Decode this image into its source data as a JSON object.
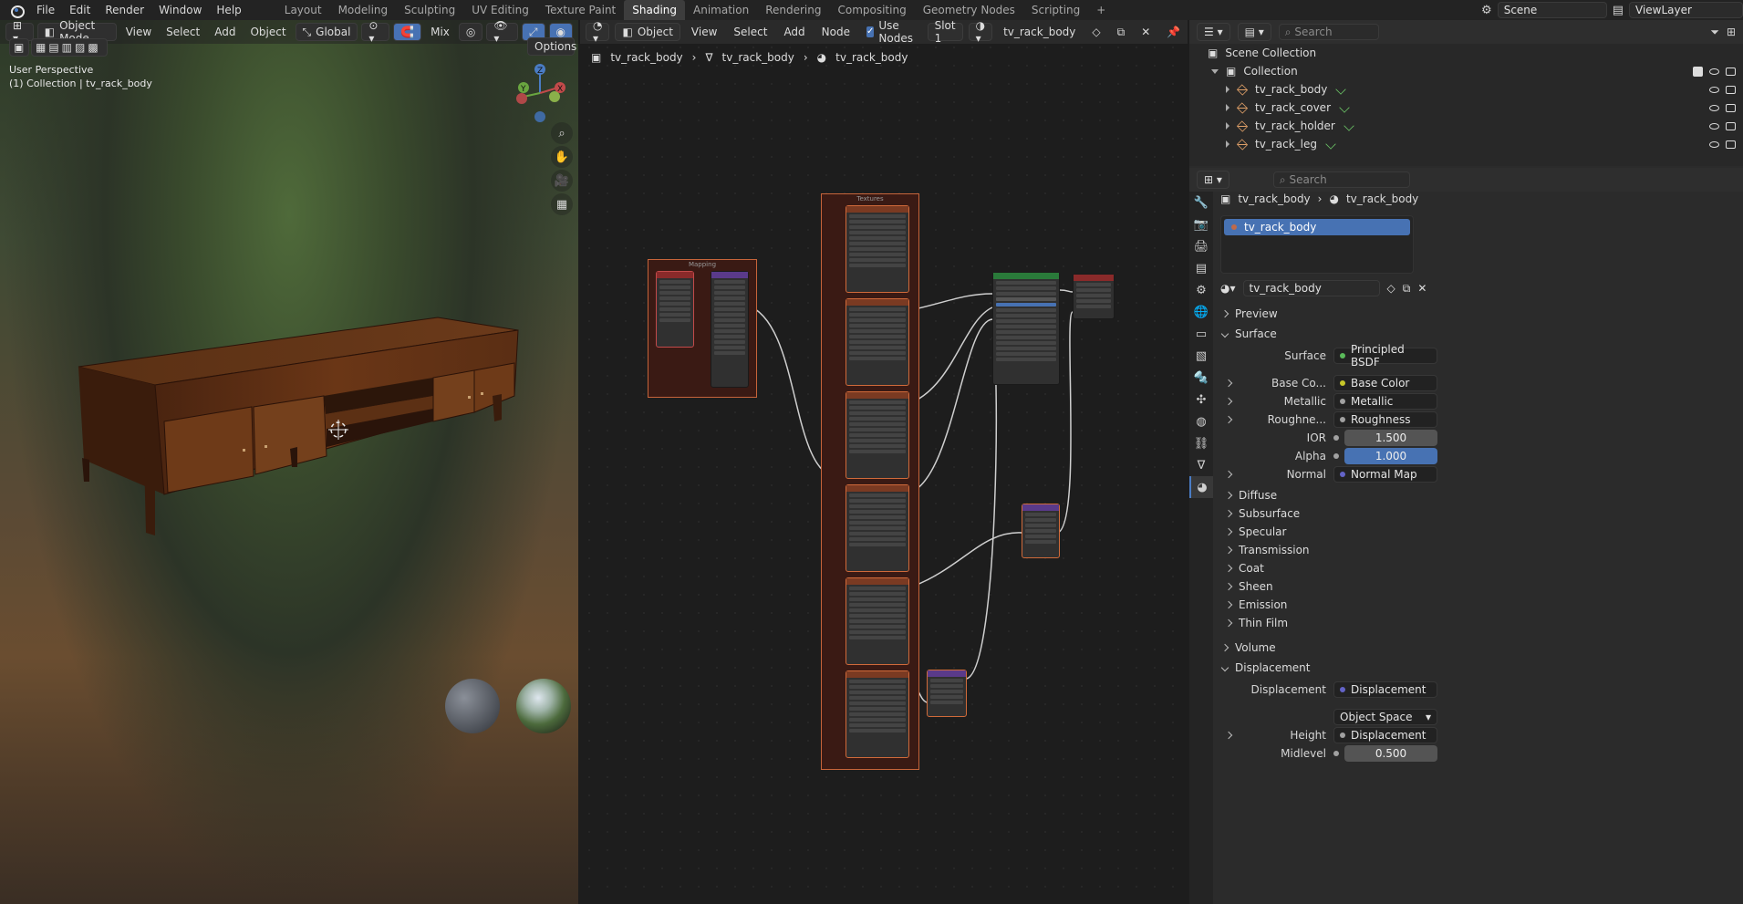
{
  "menu": {
    "file": "File",
    "edit": "Edit",
    "render": "Render",
    "window": "Window",
    "help": "Help"
  },
  "workspaces": [
    "Layout",
    "Modeling",
    "Sculpting",
    "UV Editing",
    "Texture Paint",
    "Shading",
    "Animation",
    "Rendering",
    "Compositing",
    "Geometry Nodes",
    "Scripting",
    "+"
  ],
  "active_workspace": "Shading",
  "top_right": {
    "scene": "Scene",
    "view_layer": "ViewLayer"
  },
  "viewport": {
    "mode": "Object Mode",
    "view": "View",
    "select": "Select",
    "add": "Add",
    "object": "Object",
    "transform": "Global",
    "shading_mix": "Mix",
    "options": "Options",
    "overlay_line1": "User Perspective",
    "overlay_line2": "(1) Collection | tv_rack_body",
    "axes": {
      "z": "Z",
      "y": "Y",
      "x": "X"
    }
  },
  "node_editor": {
    "type": "Object",
    "view": "View",
    "select": "Select",
    "add": "Add",
    "node": "Node",
    "use_nodes": "Use Nodes",
    "slot": "Slot 1",
    "material": "tv_rack_body",
    "breadcrumb": [
      "tv_rack_body",
      "tv_rack_body",
      "tv_rack_body"
    ],
    "frame_mapping": "Mapping",
    "frame_textures": "Textures"
  },
  "outliner": {
    "search_placeholder": "Search",
    "scene_collection": "Scene Collection",
    "collection": "Collection",
    "objects": [
      "tv_rack_body",
      "tv_rack_cover",
      "tv_rack_holder",
      "tv_rack_leg"
    ]
  },
  "properties": {
    "search_placeholder": "Search",
    "crumb_object": "tv_rack_body",
    "crumb_material": "tv_rack_body",
    "slot_name": "tv_rack_body",
    "material_name": "tv_rack_body",
    "preview": "Preview",
    "surface_header": "Surface",
    "surface_label": "Surface",
    "surface_value": "Principled BSDF",
    "rows": [
      {
        "label": "Base Co...",
        "value": "Base Color",
        "color": "#c7c729"
      },
      {
        "label": "Metallic",
        "value": "Metallic",
        "color": "#a1a1a1"
      },
      {
        "label": "Roughne...",
        "value": "Roughness",
        "color": "#a1a1a1"
      }
    ],
    "ior_label": "IOR",
    "ior_value": "1.500",
    "alpha_label": "Alpha",
    "alpha_value": "1.000",
    "normal_label": "Normal",
    "normal_value": "Normal Map",
    "subsections": [
      "Diffuse",
      "Subsurface",
      "Specular",
      "Transmission",
      "Coat",
      "Sheen",
      "Emission",
      "Thin Film"
    ],
    "volume": "Volume",
    "displacement_header": "Displacement",
    "displacement_label": "Displacement",
    "displacement_value": "Displacement",
    "space_value": "Object Space",
    "height_label": "Height",
    "height_value": "Displacement",
    "midlevel_label": "Midlevel",
    "midlevel_value": "0.500"
  }
}
